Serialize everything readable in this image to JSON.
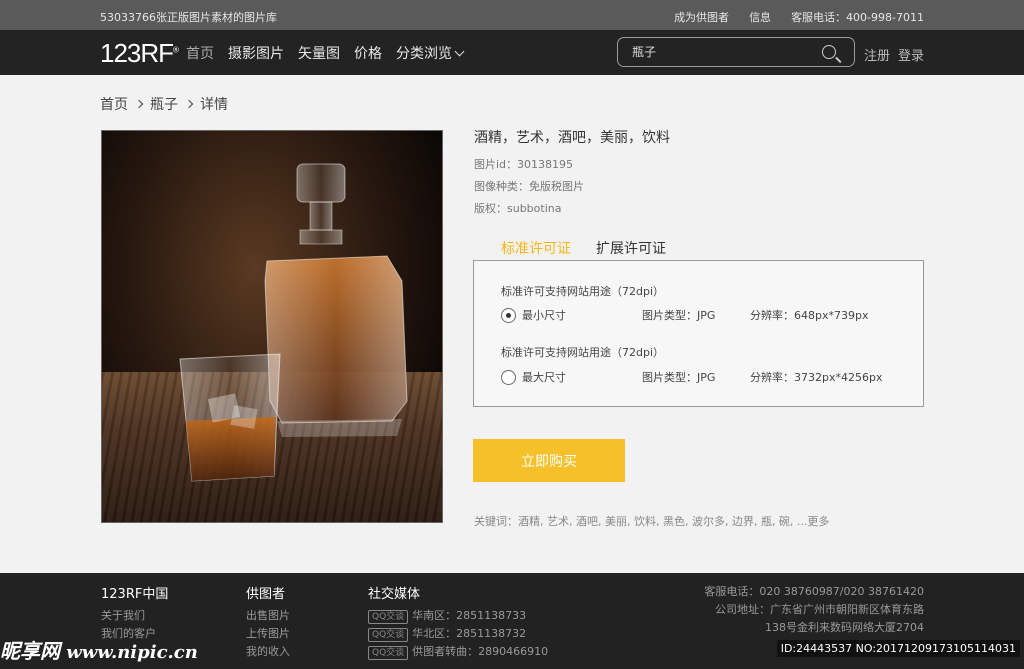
{
  "topbar": {
    "tagline": "53033766张正版图片素材的图片库",
    "links": [
      "成为供图者",
      "信息",
      "客服电话：400-998-7011"
    ]
  },
  "nav": {
    "logo": "123RF",
    "items": [
      "首页",
      "摄影图片",
      "矢量图",
      "价格",
      "分类浏览"
    ],
    "search_value": "瓶子",
    "register": "注册",
    "login": "登录"
  },
  "breadcrumb": [
    "首页",
    "瓶子",
    "详情"
  ],
  "detail": {
    "title": "酒精，艺术，酒吧，美丽，饮料",
    "image_id": "图片id：30138195",
    "image_type": "图像种类：免版税图片",
    "copyright": "版权：subbotina"
  },
  "tabs": [
    "标准许可证",
    "扩展许可证"
  ],
  "license": {
    "groups": [
      {
        "heading": "标准许可支持网站用途（72dpi）",
        "size": "最小尺寸",
        "type": "图片类型：JPG",
        "resolution": "分辨率：648px*739px",
        "selected": true
      },
      {
        "heading": "标准许可支持网站用途（72dpi）",
        "size": "最大尺寸",
        "type": "图片类型：JPG",
        "resolution": "分辨率：3732px*4256px",
        "selected": false
      }
    ]
  },
  "buy_label": "立即购买",
  "keywords": "关键词：酒精, 艺术, 酒吧, 美丽, 饮料, 黑色, 波尔多, 边界, 瓶, 碗, ...更多",
  "footer": {
    "col1": {
      "title": "123RF中国",
      "links": [
        "关于我们",
        "我们的客户"
      ]
    },
    "col2": {
      "title": "供图者",
      "links": [
        "出售图片",
        "上传图片",
        "我的收入"
      ]
    },
    "col3": {
      "title": "社交媒体",
      "qq_label": "QQ交谈",
      "lines": [
        "华南区：2851138733",
        "华北区：2851138732",
        "供图者转曲：2890466910"
      ]
    },
    "contact": [
      "客服电话：020 38760987/020 38761420",
      "公司地址：广东省广州市朝阳新区体育东路",
      "138号金利来数码网络大厦2704"
    ]
  },
  "watermark": {
    "site_cn": "昵享网",
    "site_url": "www.nipic.cn",
    "id_text": "ID:24443537 NO:20171209173105114031"
  }
}
